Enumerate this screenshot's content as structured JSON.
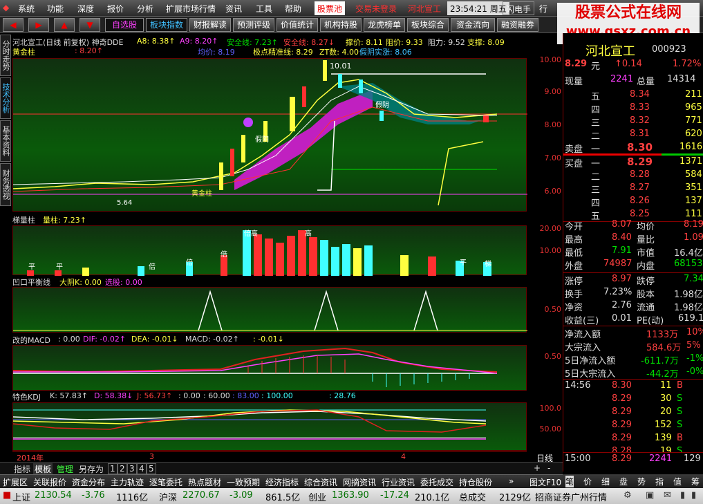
{
  "menu": {
    "items": [
      "系统",
      "功能",
      "深度",
      "报价",
      "分析",
      "扩展市场行情",
      "资讯",
      "工具",
      "帮助"
    ],
    "stock_pool": "股票池",
    "trade": "交易未登录",
    "stock_name": "河北宣工",
    "time": "23:54:21 周五",
    "flash": "闪电手",
    "hang": "行"
  },
  "toolbar": {
    "labels": [
      "自选股",
      "板块指数",
      "财报解读",
      "预测评级",
      "价值统计",
      "机构持股",
      "龙虎榜单",
      "板块综合",
      "资金流向",
      "融资融券"
    ]
  },
  "sidetabs": [
    "分时走势",
    "技术分析",
    "基本资料",
    "财务透视"
  ],
  "main_chart": {
    "title": "河北宣工(日线 前复权) 神奇DDE",
    "a8": "A8: 8.38↑",
    "a9": "A9: 8.20↑",
    "safe1": "安全线: 7.23↑",
    "safe2": "安全线: 8.27↓",
    "support_price": "撑价: 8.11",
    "resist_price": "阻价: 9.33",
    "resistance": "阻力: 9.52",
    "support": "支撑: 8.09",
    "gold_col": "黄金柱",
    "gold_col_val": ": 8.20↑",
    "avg": "均价: 8.19",
    "extreme": "极点精准线: 8.29",
    "zt": "ZT数: 4.00",
    "fake": "假阴实涨: 8.06",
    "label_high": "10.01",
    "label_low": "5.64",
    "label_fake1": "假阴",
    "label_fake2": "假阴",
    "label_gold": "黄金柱",
    "axis": [
      "10.00",
      "9.00",
      "8.00",
      "7.00",
      "6.00"
    ]
  },
  "ladder": {
    "title": "梯量柱",
    "value": "量柱: 7.23↑",
    "axis": [
      "20.00",
      "10.00"
    ],
    "labels": [
      "平",
      "平",
      "倍",
      "倍",
      "倍",
      "倍高",
      "高",
      "平",
      "梯"
    ]
  },
  "balance": {
    "title": "凹口平衡线",
    "dayin": "大阴K: 0.00",
    "select": "选股: 0.00",
    "axis": [
      "0.50"
    ]
  },
  "macd": {
    "title": "改的MACD",
    "v1": ": 0.00",
    "dif": "DIF: -0.02↑",
    "dea": "DEA: -0.01↓",
    "macd": "MACD: -0.02↑",
    "v2": ": -0.01↓",
    "axis": [
      "0.50"
    ]
  },
  "kdj": {
    "title": "特色KDJ",
    "k": "K: 57.83↑",
    "d": "D: 58.38↓",
    "j": "J: 56.73↑",
    "v": ": 0.00",
    "v60": ": 60.00",
    "v83": ": 83.00",
    "v100": ": 100.00",
    "v28": ": 28.76",
    "axis": [
      "100.0",
      "50.00"
    ]
  },
  "xaxis": {
    "labels": [
      "2014年",
      "3",
      "4"
    ],
    "period": "日线"
  },
  "bottom_tabs": [
    "指标",
    "模板",
    "管理",
    "另存为",
    "1",
    "2",
    "3",
    "4",
    "5"
  ],
  "link_tabs": [
    "扩展区",
    "关联报价",
    "资金分布",
    "主力轨迹",
    "逐笔委托",
    "热点题材",
    "一致预期",
    "经济指标",
    "综合资讯",
    "网摘资讯",
    "行业资讯",
    "委托成交",
    "持仓股份"
  ],
  "link_tabs_right": "图文F10",
  "quote_tabs": [
    "笔",
    "价",
    "细",
    "盘",
    "势",
    "指",
    "值",
    "筹"
  ],
  "quote": {
    "name": "河北宣工",
    "code": "000923",
    "price": "8.29",
    "unit": "元",
    "change": "↑0.14",
    "pct": "1.72%",
    "now_label": "现量",
    "now": "2241",
    "total_label": "总量",
    "total": "14314",
    "asks": [
      {
        "lvl": "五",
        "price": "8.34",
        "vol": "211"
      },
      {
        "lvl": "四",
        "price": "8.33",
        "vol": "965"
      },
      {
        "lvl": "三",
        "price": "8.32",
        "vol": "771"
      },
      {
        "lvl": "二",
        "price": "8.31",
        "vol": "620"
      }
    ],
    "sell_label": "卖盘",
    "sell1_lvl": "一",
    "sell1_price": "8.30",
    "sell1_vol": "1616",
    "buy_label": "买盘",
    "buy1_lvl": "一",
    "buy1_price": "8.29",
    "buy1_vol": "1371",
    "bids": [
      {
        "lvl": "二",
        "price": "8.28",
        "vol": "584"
      },
      {
        "lvl": "三",
        "price": "8.27",
        "vol": "351"
      },
      {
        "lvl": "四",
        "price": "8.26",
        "vol": "137"
      },
      {
        "lvl": "五",
        "price": "8.25",
        "vol": "111"
      }
    ],
    "stats": [
      {
        "l1": "今开",
        "v1": "8.07",
        "l2": "均价",
        "v2": "8.19"
      },
      {
        "l1": "最高",
        "v1": "8.40",
        "l2": "量比",
        "v2": "1.09"
      },
      {
        "l1": "最低",
        "v1": "7.91",
        "l2": "市值",
        "v2": "16.4亿"
      },
      {
        "l1": "外盘",
        "v1": "74987",
        "l2": "内盘",
        "v2": "68153"
      }
    ],
    "stats2": [
      {
        "l1": "涨停",
        "v1": "8.97",
        "l2": "跌停",
        "v2": "7.34"
      },
      {
        "l1": "换手",
        "v1": "7.23%",
        "l2": "股本",
        "v2": "1.98亿"
      },
      {
        "l1": "净资",
        "v1": "2.76",
        "l2": "流通",
        "v2": "1.98亿"
      },
      {
        "l1": "收益(三)",
        "v1": "0.01",
        "l2": "PE(动)",
        "v2": "619.1"
      }
    ],
    "flows": [
      {
        "label": "净流入额",
        "value": "1133万",
        "pct": "10%"
      },
      {
        "label": "大宗流入",
        "value": "584.6万",
        "pct": "5%"
      },
      {
        "label": "5日净流入额",
        "value": "-611.7万",
        "pct": "-1%"
      },
      {
        "label": "5日大宗流入",
        "value": "-44.2万",
        "pct": "-0%"
      }
    ],
    "ticks": [
      {
        "t": "14:56",
        "p": "8.30",
        "v": "11",
        "s": "B"
      },
      {
        "t": "",
        "p": "8.29",
        "v": "30",
        "s": "S"
      },
      {
        "t": "",
        "p": "8.29",
        "v": "20",
        "s": "S"
      },
      {
        "t": "",
        "p": "8.29",
        "v": "152",
        "s": "S"
      },
      {
        "t": "",
        "p": "8.29",
        "v": "139",
        "s": "B"
      },
      {
        "t": "",
        "p": "8.28",
        "v": "19",
        "s": "S"
      },
      {
        "t": "15:00",
        "p": "8.29",
        "v": "2241",
        "s": "129"
      }
    ]
  },
  "status": {
    "sh_label": "上证",
    "sh_val": "2130.54",
    "sh_chg": "-3.76",
    "sh_amt": "1116亿",
    "sz_label": "沪深",
    "sz_val": "2270.67",
    "sz_chg": "-3.09",
    "sz_amt": "861.5亿",
    "cy_label": "创业",
    "cy_val": "1363.90",
    "cy_chg": "-17.24",
    "cy_amt": "210.1亿",
    "total_label": "总成交",
    "total_amt": "2129亿",
    "broker": "招商证券广州行情"
  },
  "watermark": {
    "line1": "股票公式在线网",
    "line2": "www.gsxz.com.cn"
  }
}
